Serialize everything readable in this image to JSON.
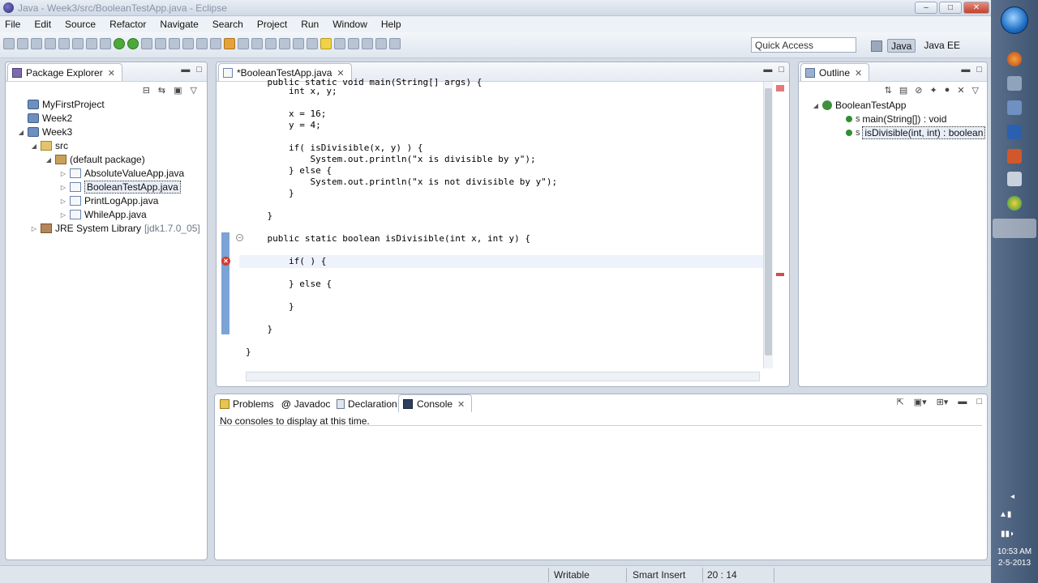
{
  "window": {
    "title": "Java - Week3/src/BooleanTestApp.java - Eclipse",
    "controls": {
      "minimize": "–",
      "maximize": "□",
      "close": "✕"
    }
  },
  "menu": [
    "File",
    "Edit",
    "Source",
    "Refactor",
    "Navigate",
    "Search",
    "Project",
    "Run",
    "Window",
    "Help"
  ],
  "toolbar": {
    "quick_access_placeholder": "Quick Access",
    "perspectives": [
      "Java",
      "Java EE"
    ]
  },
  "package_explorer": {
    "tab_label": "Package Explorer",
    "tree": [
      {
        "label": "MyFirstProject",
        "icon": "project-icon"
      },
      {
        "label": "Week2",
        "icon": "project-icon"
      },
      {
        "label": "Week3",
        "icon": "project-icon"
      },
      {
        "label": "src",
        "icon": "source-folder-icon"
      },
      {
        "label": "(default package)",
        "icon": "package-icon"
      },
      {
        "label": "AbsoluteValueApp.java",
        "icon": "java-file-icon"
      },
      {
        "label": "BooleanTestApp.java",
        "icon": "java-file-icon"
      },
      {
        "label": "PrintLogApp.java",
        "icon": "java-file-icon"
      },
      {
        "label": "WhileApp.java",
        "icon": "java-file-icon"
      },
      {
        "label": "JRE System Library",
        "version": "[jdk1.7.0_05]",
        "icon": "library-icon"
      }
    ]
  },
  "editor": {
    "tab_label": "*BooleanTestApp.java",
    "lines": [
      "    public static void main(String[] args) {",
      "        int x, y;",
      "",
      "        x = 16;",
      "        y = 4;",
      "",
      "        if( isDivisible(x, y) ) {",
      "            System.out.println(\"x is divisible by y\");",
      "        } else {",
      "            System.out.println(\"x is not divisible by y\");",
      "        }",
      "",
      "    }",
      "",
      "    public static boolean isDivisible(int x, int y) {",
      "",
      "        if( ) {",
      "",
      "        } else {",
      "",
      "        }",
      "",
      "    }",
      "",
      "}"
    ]
  },
  "outline": {
    "tab_label": "Outline",
    "class_name": "BooleanTestApp",
    "members": [
      {
        "label": "main(String[]) : void",
        "modifier": "S"
      },
      {
        "label": "isDivisible(int, int) : boolean",
        "modifier": "S"
      }
    ]
  },
  "bottom_panel": {
    "tabs": [
      "Problems",
      "Javadoc",
      "Declaration",
      "Console"
    ],
    "message": "No consoles to display at this time."
  },
  "status": {
    "mode": "Writable",
    "insert": "Smart Insert",
    "position": "20 : 14"
  },
  "clock": {
    "time": "10:53 AM",
    "date": "2-5-2013"
  }
}
